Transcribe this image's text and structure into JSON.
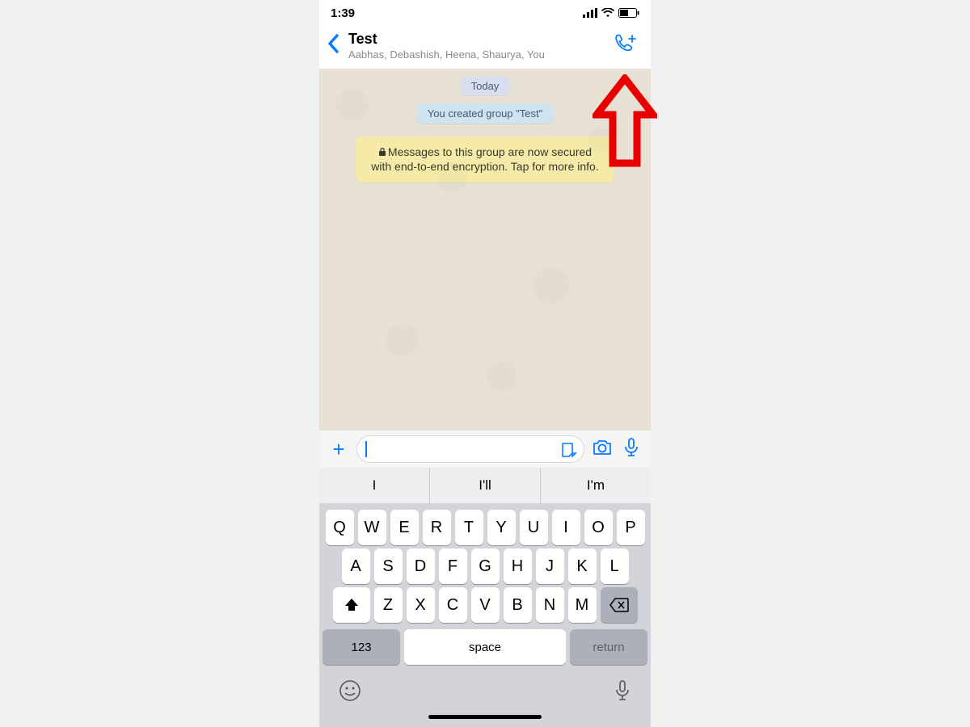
{
  "status": {
    "time": "1:39"
  },
  "header": {
    "title": "Test",
    "subtitle": "Aabhas, Debashish, Heena, Shaurya, You"
  },
  "chat": {
    "date_label": "Today",
    "system_msg": "You created group \"Test\"",
    "encryption_msg": "Messages to this group are now secured with end-to-end encryption. Tap for more info."
  },
  "suggestions": [
    "I",
    "I'll",
    "I'm"
  ],
  "keyboard": {
    "row1": [
      "Q",
      "W",
      "E",
      "R",
      "T",
      "Y",
      "U",
      "I",
      "O",
      "P"
    ],
    "row2": [
      "A",
      "S",
      "D",
      "F",
      "G",
      "H",
      "J",
      "K",
      "L"
    ],
    "row3": [
      "Z",
      "X",
      "C",
      "V",
      "B",
      "N",
      "M"
    ],
    "numeric_label": "123",
    "space_label": "space",
    "return_label": "return"
  },
  "colors": {
    "accent": "#0a7cff",
    "annotation": "#e80000"
  }
}
